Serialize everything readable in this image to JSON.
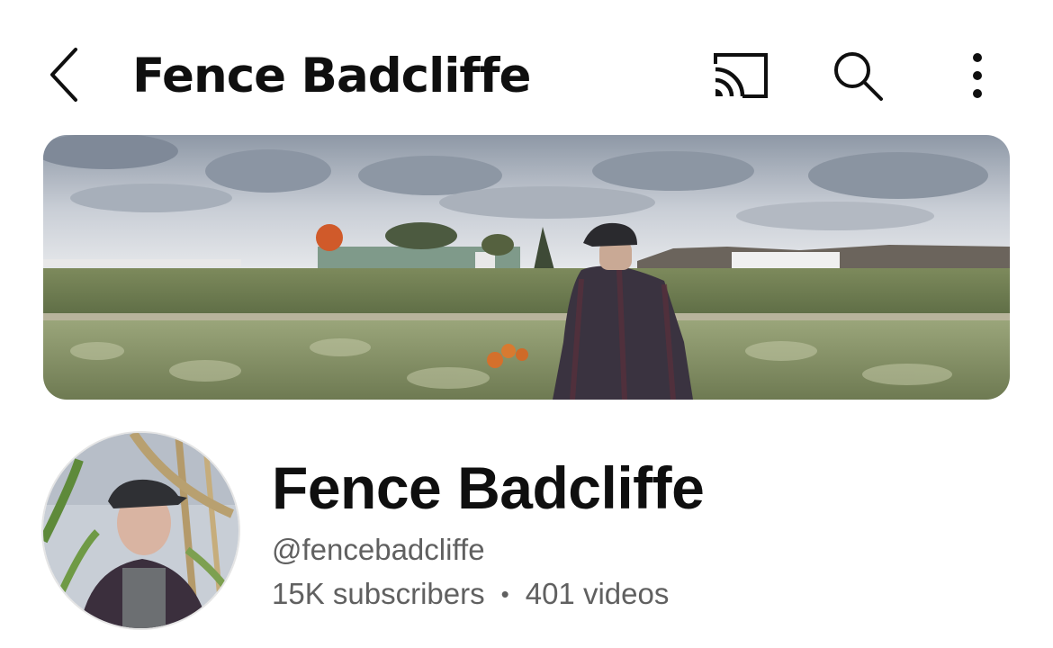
{
  "header": {
    "title": "Fence Badcliffe",
    "back_icon": "chevron-left-icon",
    "cast_icon": "cast-icon",
    "search_icon": "search-icon",
    "more_icon": "more-vertical-icon"
  },
  "channel": {
    "name": "Fence Badcliffe",
    "handle": "@fencebadcliffe",
    "subscribers": "15K subscribers",
    "separator": "•",
    "videos": "401 videos"
  },
  "colors": {
    "text_primary": "#0f0f0f",
    "text_secondary": "#606060",
    "background": "#ffffff"
  }
}
